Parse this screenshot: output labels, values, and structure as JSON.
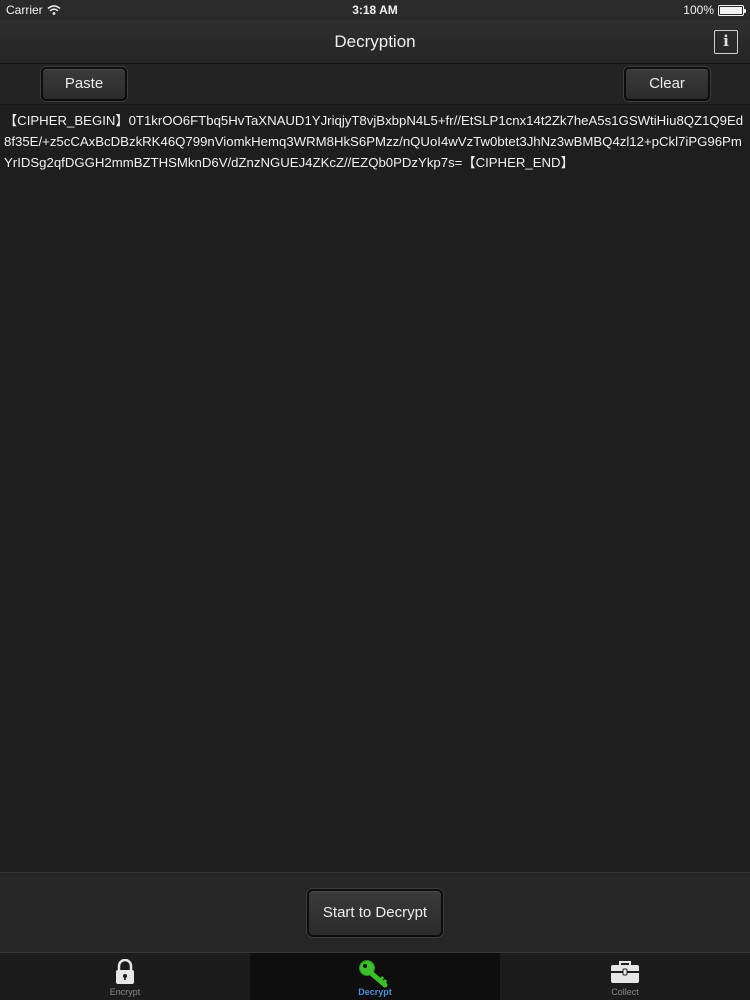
{
  "status": {
    "carrier": "Carrier",
    "time": "3:18 AM",
    "battery": "100%"
  },
  "nav": {
    "title": "Decryption",
    "info_label": "i"
  },
  "toolbar": {
    "paste_label": "Paste",
    "clear_label": "Clear"
  },
  "cipher": {
    "text": "【CIPHER_BEGIN】0T1krOO6FTbq5HvTaXNAUD1YJriqjyT8vjBxbpN4L5+fr//EtSLP1cnx14t2Zk7heA5s1GSWtiHiu8QZ1Q9Ed8f35E/+z5cCAxBcDBzkRK46Q799nViomkHemq3WRM8HkS6PMzz/nQUoI4wVzTw0btet3JhNz3wBMBQ4zl12+pCkl7iPG96PmYrIDSg2qfDGGH2mmBZTHSMknD6V/dZnzNGUEJ4ZKcZ//EZQb0PDzYkp7s=【CIPHER_END】"
  },
  "action": {
    "decrypt_label": "Start to Decrypt"
  },
  "tabs": [
    {
      "label": "Encrypt",
      "icon": "lock-icon",
      "active": false
    },
    {
      "label": "Decrypt",
      "icon": "key-icon",
      "active": true
    },
    {
      "label": "Collect",
      "icon": "briefcase-icon",
      "active": false
    }
  ],
  "colors": {
    "key_green": "#3cbf2c",
    "active_tab_label": "#4f8fd8"
  }
}
